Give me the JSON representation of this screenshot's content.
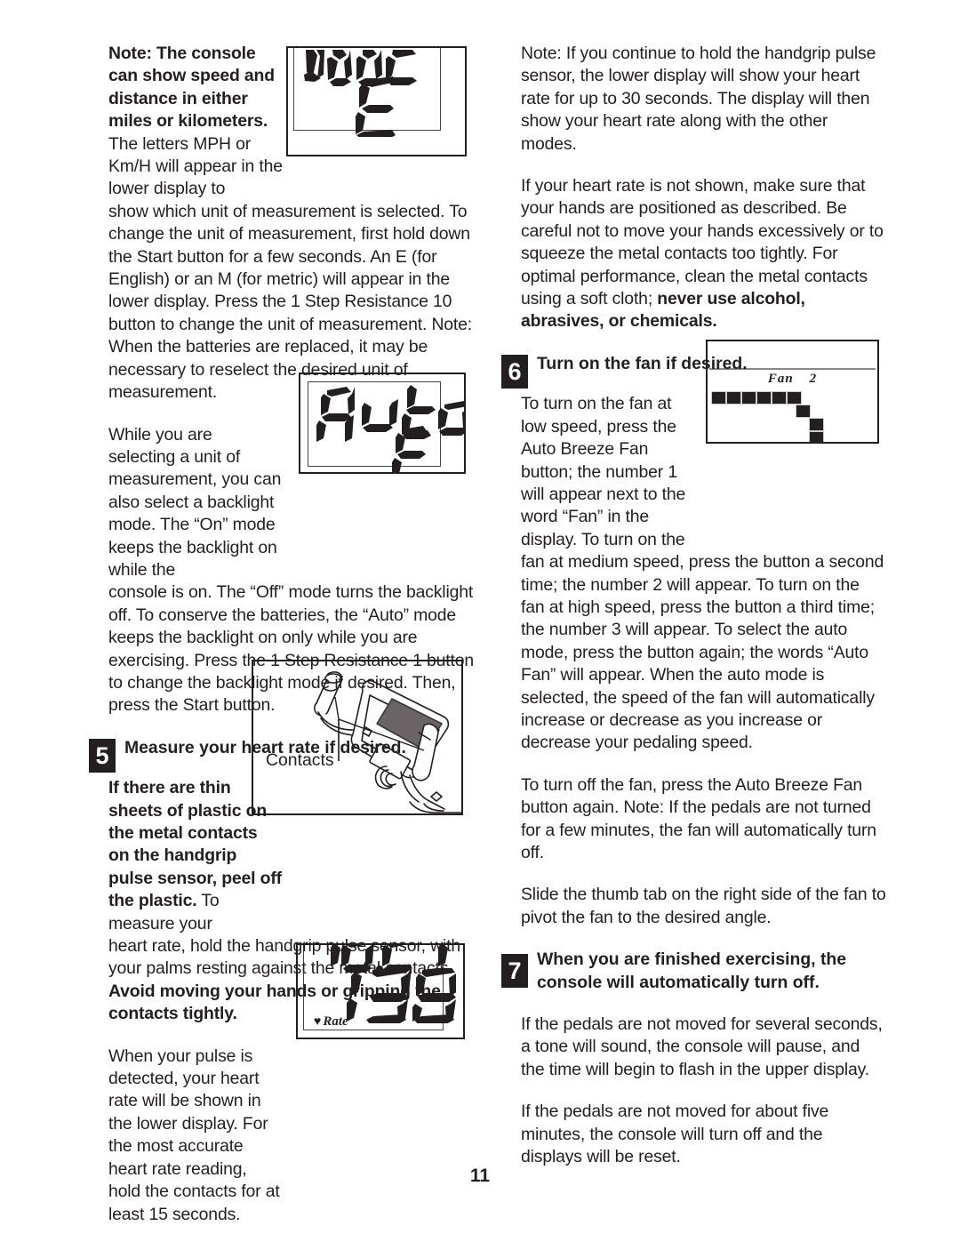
{
  "page": {
    "number": "11"
  },
  "left_column": {
    "p1_bold": "Note: The console can show speed and distance in either miles or kilometers.",
    "p1_rest": " The letters MPH or Km/H will appear in the lower display to",
    "p1_cont": "show which unit of measurement is selected. To change the unit of measurement, first hold down the Start button for a few seconds. An E (for English) or an M (for metric) will appear in the lower display. Press the 1 Step Resistance 10 button to change the unit of measurement. Note: When the batteries are replaced, it may be necessary to reselect the desired unit of measurement.",
    "p2_narrow": "While you are selecting a unit of measurement, you can also select a backlight mode. The “On” mode keeps the backlight on while the",
    "p2_cont": "console is on. The “Off” mode turns the backlight off. To conserve the batteries, the “Auto” mode keeps the backlight on only while you are exercising. Press the 1 Step Resistance 1 button to change the backlight mode if desired. Then, press the Start button.",
    "step5": {
      "number": "5",
      "heading": "Measure your heart rate if desired.",
      "p_bold_narrow": "If there are thin sheets of plastic on the metal contacts on the handgrip pulse sensor, peel off the plastic.",
      "p_rest_narrow": " To measure your",
      "p_cont": "heart rate, hold the handgrip pulse sensor, with your palms resting against the metal contacts. ",
      "p_cont_bold": "Avoid moving your hands or gripping the contacts tightly.",
      "p_last": "When your pulse is detected, your heart rate will be shown in the lower display. For the most accurate heart rate reading, hold the contacts for at least 15 seconds."
    }
  },
  "right_column": {
    "p1": "Note: If you continue to hold the handgrip pulse sensor, the lower display will show your heart rate for up to 30 seconds. The display will then show your heart rate along with the other modes.",
    "p2_a": "If your heart rate is not shown, make sure that your hands are positioned as described. Be careful not to move your hands excessively or to squeeze the metal contacts too tightly. For optimal performance, clean the metal contacts using a soft cloth; ",
    "p2_bold": "never use alcohol, abrasives, or chemicals.",
    "step6": {
      "number": "6",
      "heading": "Turn on the fan if desired.",
      "p_narrow": "To turn on the fan at low speed, press the Auto Breeze Fan button; the number 1 will appear next to the word “Fan” in the display. To turn on the",
      "p_cont": "fan at medium speed, press the button a second time; the number 2 will appear. To turn on the fan at high speed, press the button a third time; the number 3 will appear. To select the auto mode, press the button again; the words “Auto Fan” will appear. When the auto mode is selected, the speed of the fan will automatically increase or decrease as you increase or decrease your pedaling speed.",
      "p_off": "To turn off the fan, press the Auto Breeze Fan button again. Note: If the pedals are not turned for a few minutes, the fan will automatically turn off.",
      "p_tab": "Slide the thumb tab on the right side of the fan to pivot the fan to the desired angle."
    },
    "step7": {
      "number": "7",
      "heading": "When you are finished exercising, the console will automatically turn off.",
      "p1": "If the pedals are not moved for several seconds, a tone will sound, the console will pause, and the time will begin to flash in the upper display.",
      "p2": "If the pedals are not moved for about five minutes, the console will turn off and the displays will be reset."
    }
  },
  "figures": {
    "mode_display": {
      "upper_text": "MODE",
      "lower_text": "E"
    },
    "auto_display": {
      "upper_text": "Auto",
      "lower_text": "E"
    },
    "console_drawing": {
      "callout": "Contacts"
    },
    "heart_display": {
      "upper_text": "102.1",
      "lower_text": "138",
      "indicator": "Rate",
      "heart_icon": "♥"
    },
    "fan_display": {
      "label": "Fan",
      "speed": "2",
      "bars": 10
    }
  },
  "colors": {
    "ink": "#231f20",
    "lcd_frame": "#4a4244",
    "lcd_grid": "#cfcacb"
  }
}
